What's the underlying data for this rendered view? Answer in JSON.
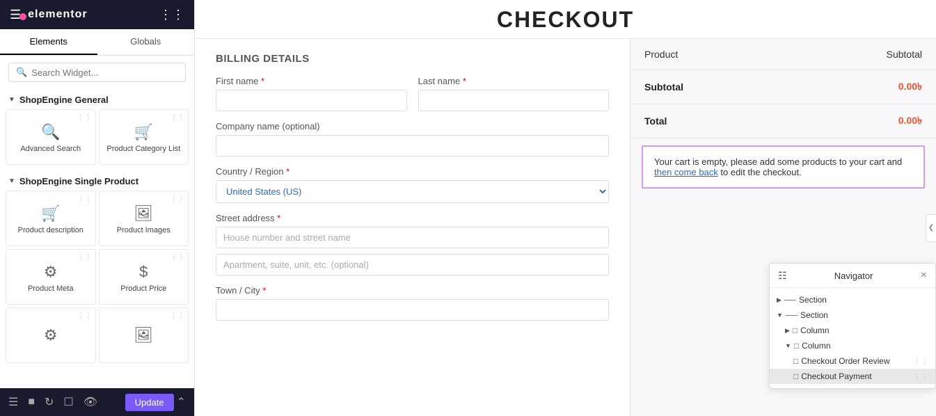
{
  "app": {
    "title": "elementor"
  },
  "sidebar": {
    "tabs": [
      {
        "id": "elements",
        "label": "Elements",
        "active": true
      },
      {
        "id": "globals",
        "label": "Globals",
        "active": false
      }
    ],
    "search_placeholder": "Search Widget...",
    "sections": [
      {
        "id": "shopengine-general",
        "title": "ShopEngine General",
        "widgets": [
          {
            "id": "advanced-search",
            "label": "Advanced Search",
            "icon": "🔍"
          },
          {
            "id": "product-category-list",
            "label": "Product Category List",
            "icon": "🛒"
          }
        ]
      },
      {
        "id": "shopengine-single-product",
        "title": "ShopEngine Single Product",
        "widgets": [
          {
            "id": "product-description",
            "label": "Product description",
            "icon": "🛒"
          },
          {
            "id": "product-images",
            "label": "Product Images",
            "icon": "🖼"
          },
          {
            "id": "product-meta",
            "label": "Product Meta",
            "icon": "⚙"
          },
          {
            "id": "product-price",
            "label": "Product Price",
            "icon": "💲"
          },
          {
            "id": "widget-5",
            "label": "",
            "icon": "⚙"
          },
          {
            "id": "widget-6",
            "label": "",
            "icon": "🖼"
          }
        ]
      }
    ]
  },
  "bottom_bar": {
    "update_label": "Update"
  },
  "page": {
    "title": "CHECKOUT",
    "billing_title": "BILLING DETAILS",
    "form": {
      "first_name_label": "First name ",
      "first_name_required": "*",
      "last_name_label": "Last name ",
      "last_name_required": "*",
      "company_label": "Company name (optional)",
      "country_label": "Country / Region ",
      "country_required": "*",
      "country_value": "United States (US)",
      "street_label": "Street address ",
      "street_required": "*",
      "street_placeholder": "House number and street name",
      "apartment_placeholder": "Apartment, suite, unit, etc. (optional)",
      "city_label": "Town / City ",
      "city_required": "*"
    }
  },
  "order_summary": {
    "col_product": "Product",
    "col_subtotal": "Subtotal",
    "subtotal_label": "Subtotal",
    "subtotal_value": "0.00৳",
    "total_label": "Total",
    "total_value": "0.00৳",
    "cart_empty_text": "Your cart is empty, please add some products to your cart and then come back to edit the checkout.",
    "cart_empty_link_text": "then come back"
  },
  "navigator": {
    "title": "Navigator",
    "items": [
      {
        "id": "section-1",
        "label": "Section",
        "level": 0,
        "expanded": false,
        "icon": "section"
      },
      {
        "id": "section-2",
        "label": "Section",
        "level": 0,
        "expanded": true,
        "icon": "section"
      },
      {
        "id": "column-1",
        "label": "Column",
        "level": 1,
        "expanded": false,
        "icon": "column"
      },
      {
        "id": "column-2",
        "label": "Column",
        "level": 1,
        "expanded": true,
        "icon": "column"
      },
      {
        "id": "checkout-order-review",
        "label": "Checkout Order Review",
        "level": 2,
        "expanded": false,
        "icon": "widget",
        "highlighted": false
      },
      {
        "id": "checkout-payment",
        "label": "Checkout Payment",
        "level": 2,
        "expanded": false,
        "icon": "widget",
        "highlighted": true
      }
    ]
  }
}
